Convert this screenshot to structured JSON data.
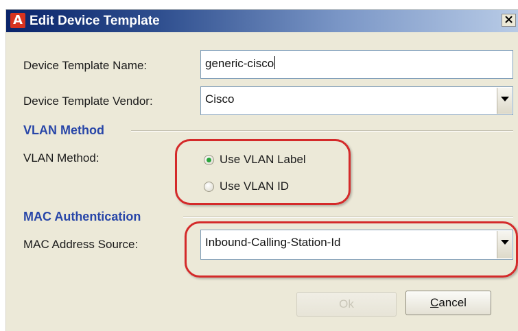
{
  "window": {
    "title": "Edit Device Template",
    "app_icon_letter": "A",
    "close_glyph": "×"
  },
  "fields": {
    "name_label": "Device Template Name:",
    "name_value": "generic-cisco",
    "vendor_label": "Device Template Vendor:",
    "vendor_value": "Cisco"
  },
  "vlan": {
    "section_title": "VLAN Method",
    "label": "VLAN Method:",
    "options": [
      {
        "label": "Use VLAN Label",
        "selected": true
      },
      {
        "label": "Use VLAN ID",
        "selected": false
      }
    ]
  },
  "mac": {
    "section_title": "MAC Authentication",
    "label": "MAC Address Source:",
    "value": "Inbound-Calling-Station-Id"
  },
  "buttons": {
    "ok_label": "Ok",
    "cancel_label": "Cancel"
  },
  "colors": {
    "section_title": "#2846a8",
    "highlight_annotation": "#d42a2a",
    "radio_selected": "#29a43a"
  },
  "icons": {
    "app": "app-logo-icon",
    "close": "close-icon",
    "dropdown": "chevron-down-icon"
  }
}
